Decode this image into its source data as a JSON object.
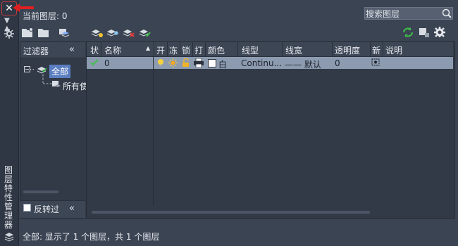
{
  "window": {
    "vertical_title": "图层特性管理器",
    "close_label": "✕"
  },
  "header": {
    "current_layer_label": "当前图层: 0",
    "search_placeholder": "搜索图层"
  },
  "filters": {
    "title": "过滤器",
    "collapse": "«",
    "tree": [
      {
        "label": "全部",
        "selected": true
      },
      {
        "label": "所有使"
      }
    ],
    "invert_label": "反转过",
    "invert_checked": false
  },
  "grid": {
    "columns": [
      "状",
      "名称",
      "开",
      "冻",
      "锁",
      "打",
      "颜色",
      "线型",
      "线宽",
      "透明度",
      "新",
      "说明"
    ],
    "rows": [
      {
        "status_icon": "check-icon",
        "name": "0",
        "color_name": "白",
        "linetype": "Continu...",
        "lineweight": "—— 默认",
        "transparency": "0"
      }
    ]
  },
  "status_text": "全部: 显示了 1 个图层，共 1 个图层",
  "colors": {
    "accent": "#5b7ec1",
    "row_selected": "#8c9bb0",
    "bg": "#3b4453",
    "current_check": "#3fbf4a"
  }
}
